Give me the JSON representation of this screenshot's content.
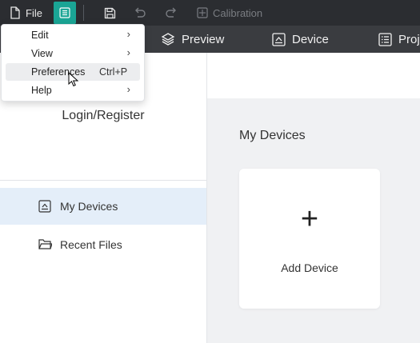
{
  "toolbar": {
    "file_label": "File",
    "calibration_label": "Calibration"
  },
  "nav": {
    "tabs": [
      "Preview",
      "Device",
      "Proj"
    ]
  },
  "menu": {
    "items": [
      {
        "label": "Edit",
        "shortcut": "",
        "submenu": true
      },
      {
        "label": "View",
        "shortcut": "",
        "submenu": true
      },
      {
        "label": "Preferences",
        "shortcut": "Ctrl+P",
        "submenu": false
      },
      {
        "label": "Help",
        "shortcut": "",
        "submenu": true
      }
    ]
  },
  "sidebar": {
    "login_label": "Login/Register",
    "items": [
      {
        "label": "My Devices",
        "active": true
      },
      {
        "label": "Recent Files",
        "active": false
      }
    ]
  },
  "main": {
    "title": "My Devices",
    "add_device_label": "Add Device",
    "add_symbol": "+"
  },
  "colors": {
    "accent": "#1aa595",
    "topbar": "#2b2d31",
    "navbar": "#3a3c40",
    "active_item": "#e4eef9"
  }
}
